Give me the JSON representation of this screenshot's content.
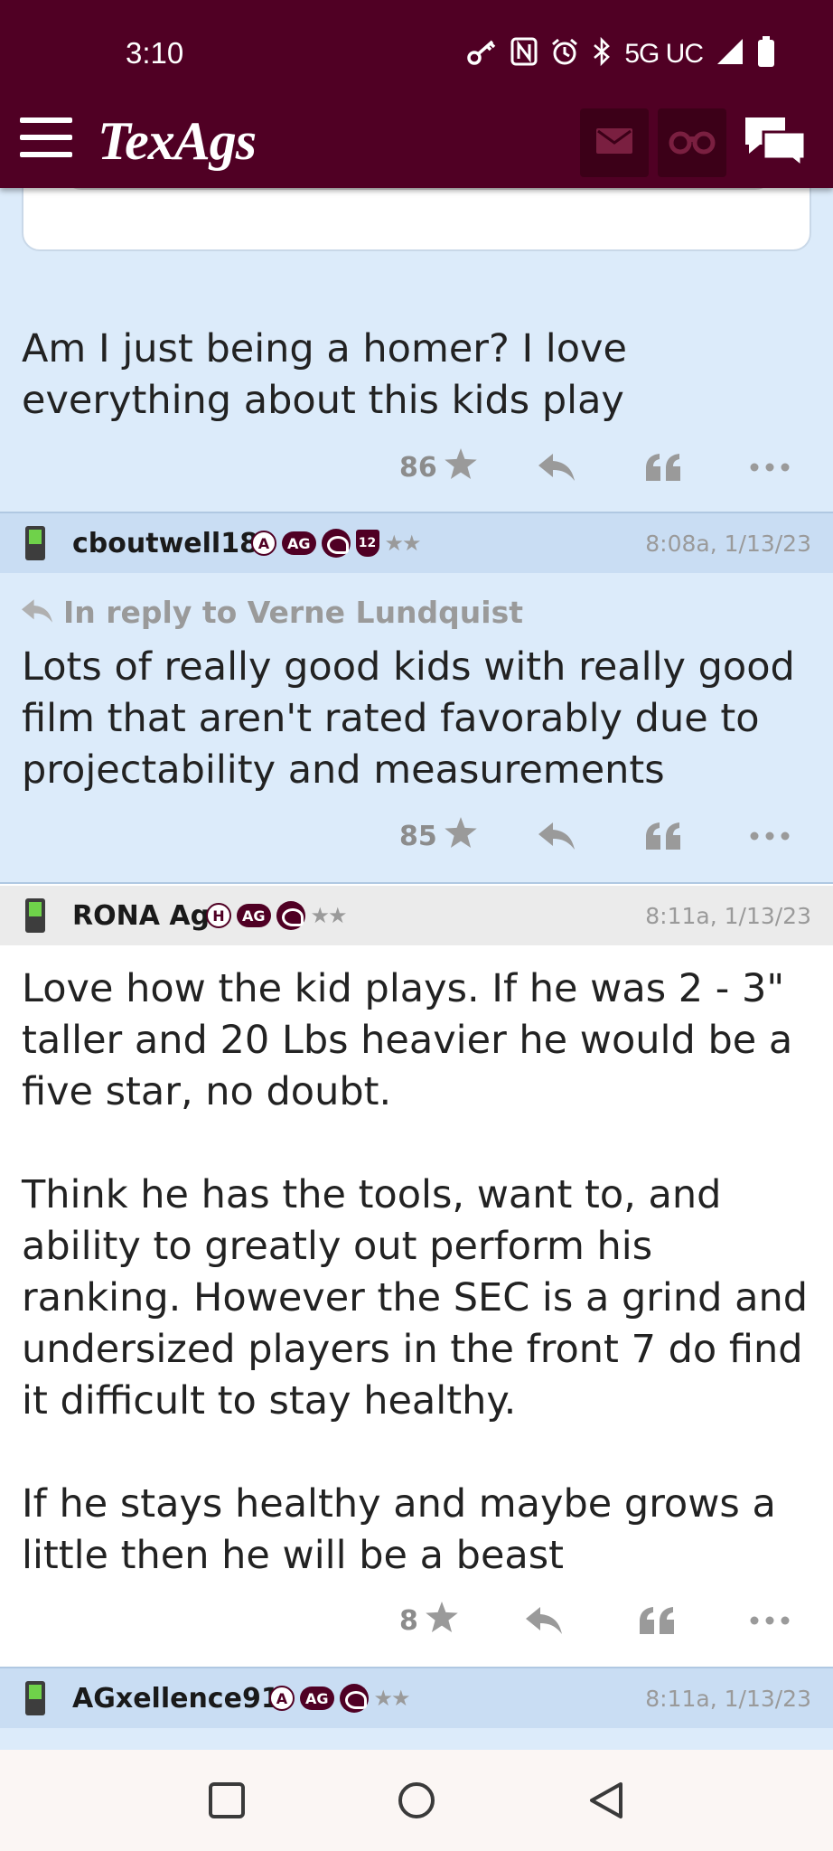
{
  "status_bar": {
    "time": "3:10",
    "network": "5G UC",
    "icons": [
      "key-icon",
      "nfc-icon",
      "alarm-icon",
      "bluetooth-icon",
      "signal-icon",
      "battery-icon"
    ]
  },
  "header": {
    "logo": "TexAgs",
    "brand_color": "#500024",
    "icons": [
      "menu-icon",
      "mail-icon",
      "binoculars-icon",
      "chat-icon"
    ]
  },
  "posts": [
    {
      "body": "Am I just being a homer? I love everything about this kids play",
      "likes": "86"
    },
    {
      "username": "cboutwell18",
      "badges": [
        "A",
        "AG",
        "helmet",
        "12",
        "★★"
      ],
      "timestamp": "8:08a, 1/13/23",
      "reply_to": "In reply to Verne Lundquist",
      "body": "Lots of really good kids with really good film that aren't rated favorably due to projectability and measurements",
      "likes": "85"
    },
    {
      "username": "RONA Ag",
      "badges": [
        "H",
        "AG",
        "helmet",
        "★★"
      ],
      "timestamp": "8:11a, 1/13/23",
      "body": "Love how the kid plays. If he was 2 - 3\" taller and 20 Lbs heavier he would be a five star, no doubt.\n\nThink he has the tools, want to, and ability to greatly out perform his ranking. However the SEC is a grind and undersized players in the front 7 do find it difficult to stay healthy.\n\nIf he stays healthy and maybe grows a little then he will be a beast",
      "likes": "8"
    },
    {
      "username": "AGxellence91",
      "badges": [
        "A",
        "AG",
        "helmet",
        "★★"
      ],
      "timestamp": "8:11a, 1/13/23"
    }
  ],
  "navbar": {
    "icons": [
      "recents-icon",
      "home-icon",
      "back-icon"
    ]
  }
}
